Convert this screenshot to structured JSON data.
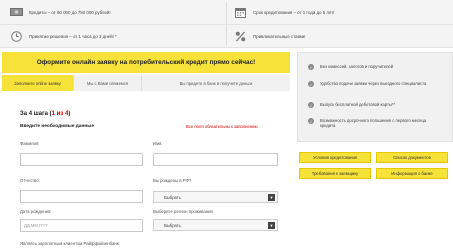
{
  "features": {
    "credit_amount": "Кредиты – от 50 000 до 750 000 рублей!",
    "credit_term": "Срок кредитования – от 1 года до 5 лет!",
    "decision_time": "Принятие решения – от 1 часа до 3 дней! *",
    "rates": "Привлекательные ставки!"
  },
  "banner": {
    "title": "Оформите онлайн заявку на потребительский кредит прямо сейчас!"
  },
  "steps": [
    {
      "label": "Заполните online заявку"
    },
    {
      "label": "Мы с Вами свяжемся"
    },
    {
      "label": "Вы придете в банк и получите деньги"
    }
  ],
  "form": {
    "step_prefix": "За 4 шага (",
    "step_current": "1 из 4",
    "step_suffix": ")",
    "title": "Введите необходимые данные",
    "required_note": "Все поля обязательны к заполнению",
    "fields": {
      "lastname_label": "Фамилия:",
      "firstname_label": "Имя:",
      "patronymic_label": "Отчество:",
      "birthplace_label": "Вы рождены в РФ?",
      "birthplace_value": "Выбрать",
      "birthdate_label": "Дата рождения:",
      "birthdate_placeholder": "ДД.ММ.ГГГГ",
      "region_label": "Выберите регион проживания",
      "region_value": "Выбрать",
      "cardholder_label": "Являясь зарплатным клиентом Райффайзенбанк"
    }
  },
  "sidebar": {
    "items": [
      {
        "label": "Без комиссий, залогов и поручителей"
      },
      {
        "label": "Удобство подачи заявки через выездного специалиста"
      },
      {
        "label": "Выпуск бесплатной дебетовой карты**"
      },
      {
        "label": "Возможность досрочного погашения с первого месяца кредита"
      }
    ]
  },
  "buttons": {
    "conditions": "Условия кредитования",
    "documents": "Список документов",
    "borrower": "Требования к заемщику",
    "bank_info": "Информация о банке"
  },
  "colors": {
    "accent": "#f7e23a",
    "required": "#d00000"
  }
}
